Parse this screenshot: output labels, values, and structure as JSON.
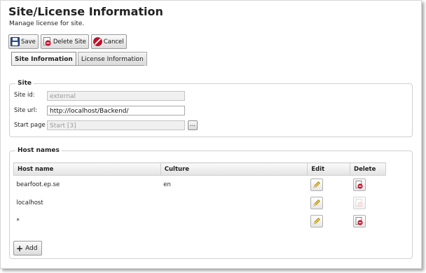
{
  "page": {
    "title": "Site/License Information",
    "subtitle": "Manage license for site."
  },
  "toolbar": {
    "save_label": "Save",
    "delete_label": "Delete Site",
    "cancel_label": "Cancel"
  },
  "tabs": [
    {
      "label": "Site Information",
      "active": true
    },
    {
      "label": "License Information",
      "active": false
    }
  ],
  "site": {
    "legend": "Site",
    "site_id_label": "Site id:",
    "site_id_value": "external",
    "site_url_label": "Site url:",
    "site_url_value": "http://localhost/Backend/",
    "start_page_label": "Start page",
    "start_page_value": "Start [3]",
    "browse_label": "..."
  },
  "hosts": {
    "legend": "Host names",
    "columns": {
      "host": "Host name",
      "culture": "Culture",
      "edit": "Edit",
      "delete": "Delete"
    },
    "rows": [
      {
        "host": "bearfoot.ep.se",
        "culture": "en",
        "delete_enabled": true
      },
      {
        "host": "localhost",
        "culture": "",
        "delete_enabled": false
      },
      {
        "host": "*",
        "culture": "",
        "delete_enabled": true
      }
    ],
    "add_label": "Add"
  },
  "colors": {
    "delete_red": "#c8102e",
    "save_blue": "#2a4f8a",
    "pencil_yellow": "#e8c23a"
  }
}
